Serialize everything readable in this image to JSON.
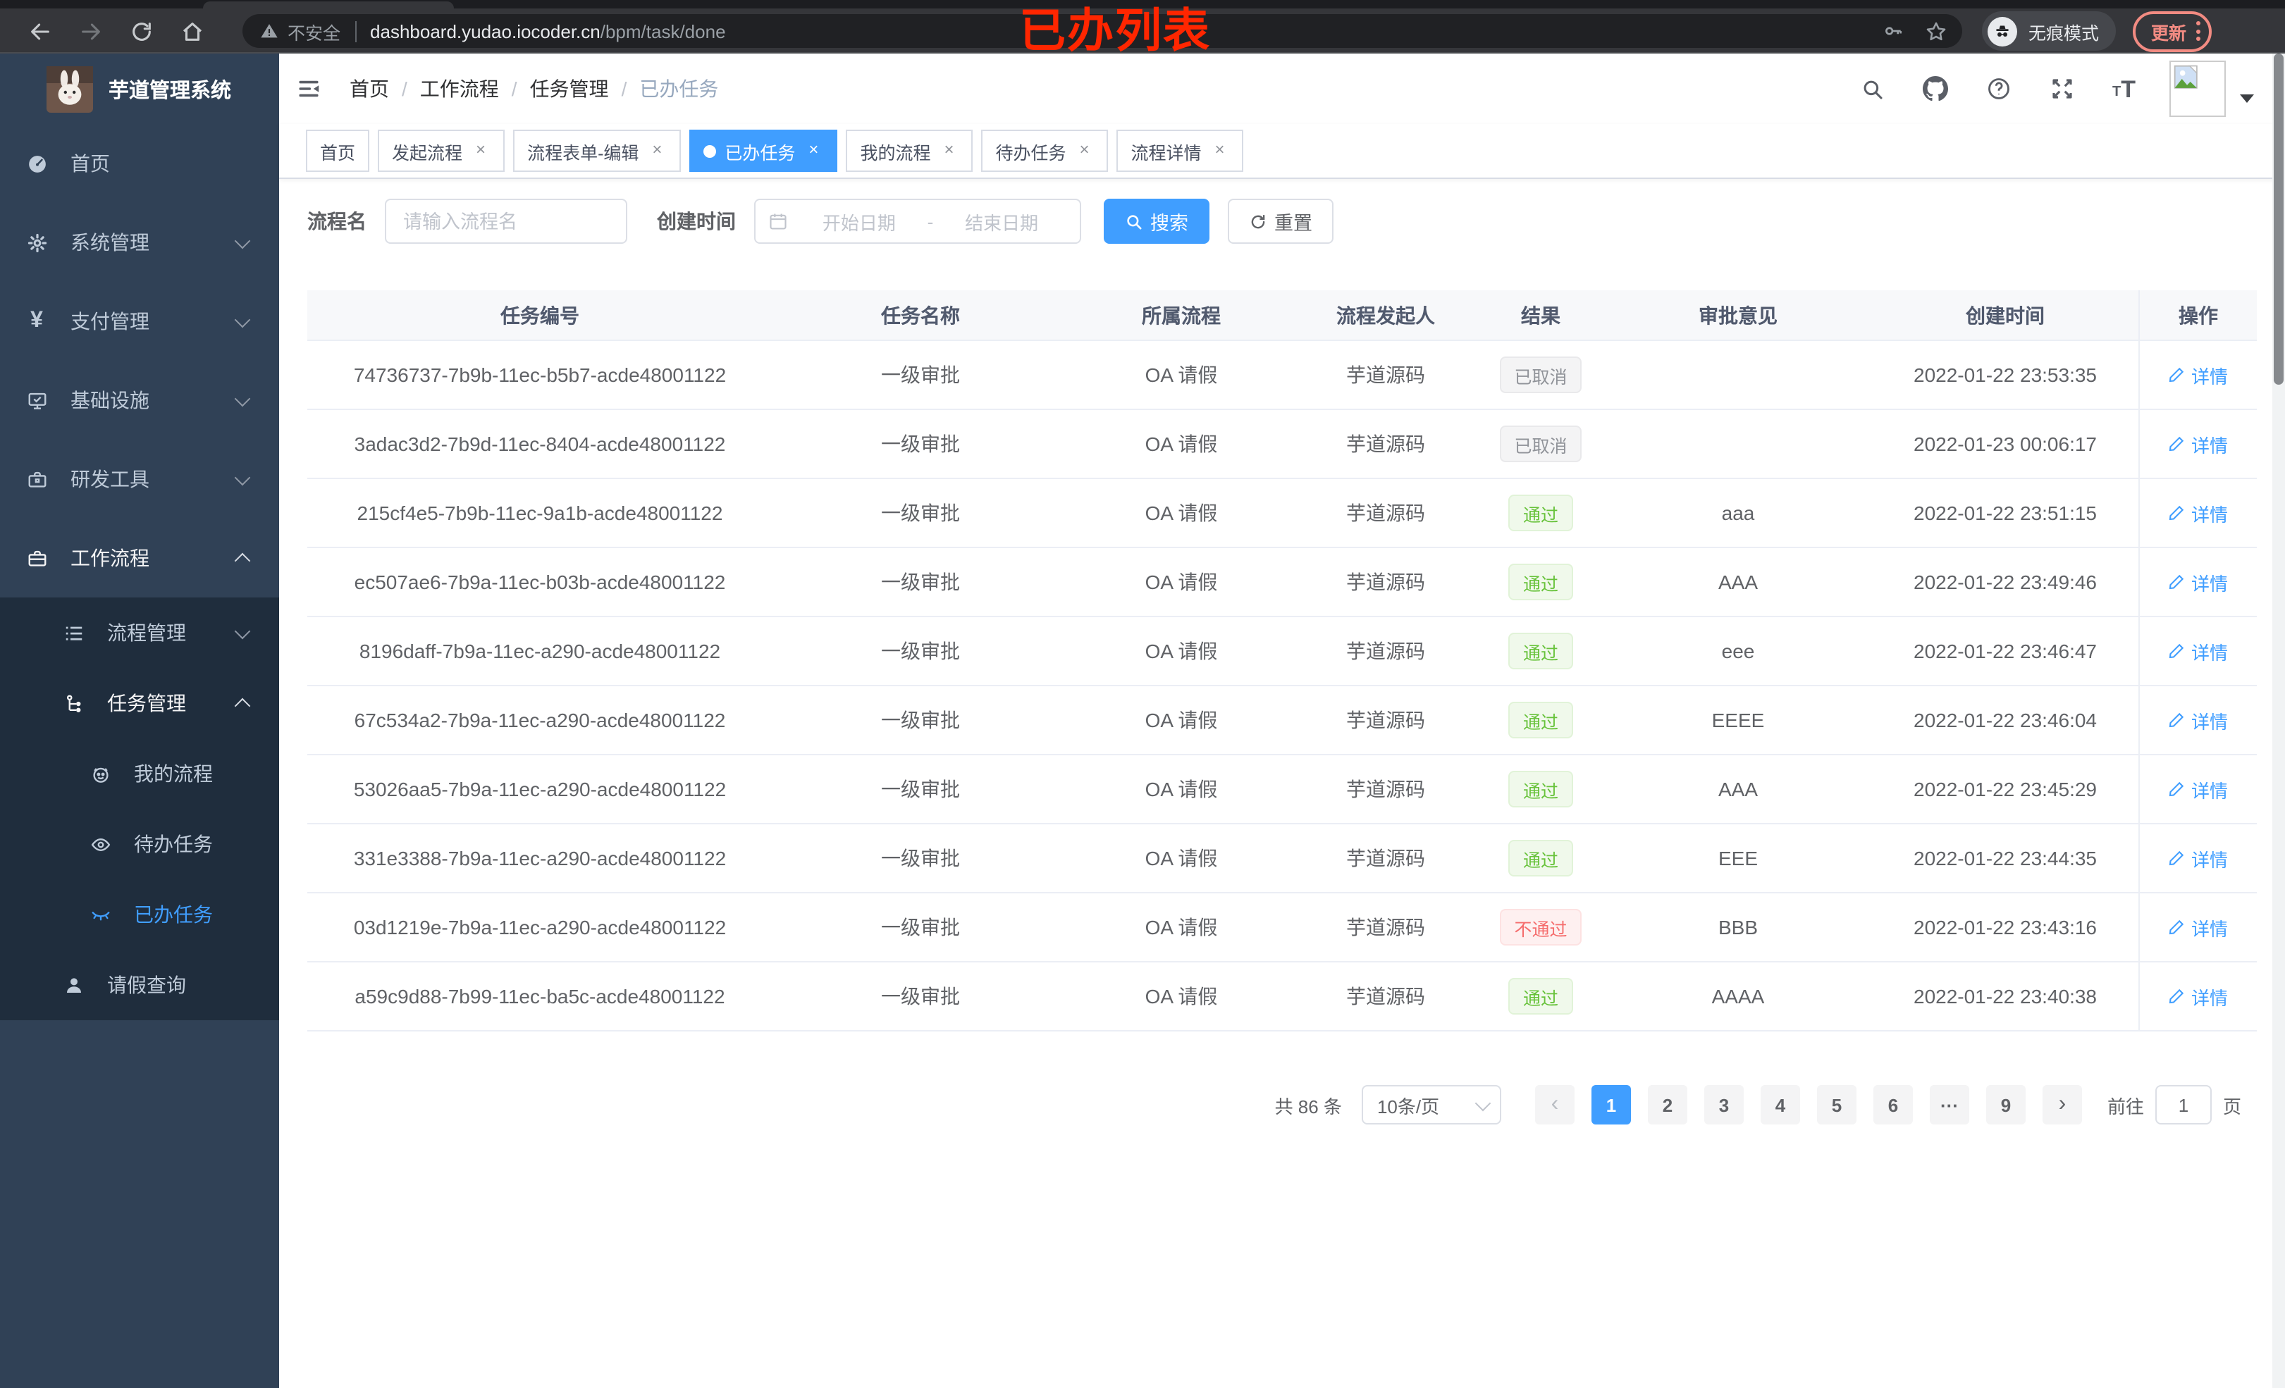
{
  "browser": {
    "security_label": "不安全",
    "url_host": "dashboard.yudao.iocoder.cn",
    "url_path": "/bpm/task/done",
    "overlay_title": "已办列表",
    "incognito_label": "无痕模式",
    "update_label": "更新"
  },
  "sidebar": {
    "app_title": "芋道管理系统",
    "menu": [
      {
        "label": "首页",
        "icon": "dashboard-icon"
      },
      {
        "label": "系统管理",
        "icon": "gear-icon"
      },
      {
        "label": "支付管理",
        "icon": "yen-icon"
      },
      {
        "label": "基础设施",
        "icon": "monitor-icon"
      },
      {
        "label": "研发工具",
        "icon": "toolbox-icon"
      },
      {
        "label": "工作流程",
        "icon": "briefcase-icon"
      },
      {
        "label": "流程管理",
        "icon": "list-tree-icon"
      },
      {
        "label": "任务管理",
        "icon": "flow-tree-icon"
      },
      {
        "label": "我的流程",
        "icon": "face-icon"
      },
      {
        "label": "待办任务",
        "icon": "eye-open-icon"
      },
      {
        "label": "已办任务",
        "icon": "eye-closed-icon"
      },
      {
        "label": "请假查询",
        "icon": "user-icon"
      }
    ]
  },
  "header": {
    "breadcrumb": [
      "首页",
      "工作流程",
      "任务管理",
      "已办任务"
    ],
    "breadcrumb_separator": "/"
  },
  "tabs": {
    "close_glyph": "×",
    "items": [
      {
        "label": "首页",
        "closable": false,
        "active": false
      },
      {
        "label": "发起流程",
        "closable": true,
        "active": false
      },
      {
        "label": "流程表单-编辑",
        "closable": true,
        "active": false
      },
      {
        "label": "已办任务",
        "closable": true,
        "active": true
      },
      {
        "label": "我的流程",
        "closable": true,
        "active": false
      },
      {
        "label": "待办任务",
        "closable": true,
        "active": false
      },
      {
        "label": "流程详情",
        "closable": true,
        "active": false
      }
    ]
  },
  "filters": {
    "name_label": "流程名",
    "name_placeholder": "请输入流程名",
    "time_label": "创建时间",
    "start_placeholder": "开始日期",
    "range_separator": "-",
    "end_placeholder": "结束日期",
    "search_label": "搜索",
    "reset_label": "重置"
  },
  "table": {
    "columns": [
      "任务编号",
      "任务名称",
      "所属流程",
      "流程发起人",
      "结果",
      "审批意见",
      "创建时间",
      "操作"
    ],
    "action_label": "详情",
    "rows": [
      {
        "id": "74736737-7b9b-11ec-b5b7-acde48001122",
        "name": "一级审批",
        "process": "OA 请假",
        "starter": "芋道源码",
        "result": "已取消",
        "result_type": "info",
        "opinion": "",
        "time": "2022-01-22 23:53:35"
      },
      {
        "id": "3adac3d2-7b9d-11ec-8404-acde48001122",
        "name": "一级审批",
        "process": "OA 请假",
        "starter": "芋道源码",
        "result": "已取消",
        "result_type": "info",
        "opinion": "",
        "time": "2022-01-23 00:06:17"
      },
      {
        "id": "215cf4e5-7b9b-11ec-9a1b-acde48001122",
        "name": "一级审批",
        "process": "OA 请假",
        "starter": "芋道源码",
        "result": "通过",
        "result_type": "success",
        "opinion": "aaa",
        "time": "2022-01-22 23:51:15"
      },
      {
        "id": "ec507ae6-7b9a-11ec-b03b-acde48001122",
        "name": "一级审批",
        "process": "OA 请假",
        "starter": "芋道源码",
        "result": "通过",
        "result_type": "success",
        "opinion": "AAA",
        "time": "2022-01-22 23:49:46"
      },
      {
        "id": "8196daff-7b9a-11ec-a290-acde48001122",
        "name": "一级审批",
        "process": "OA 请假",
        "starter": "芋道源码",
        "result": "通过",
        "result_type": "success",
        "opinion": "eee",
        "time": "2022-01-22 23:46:47"
      },
      {
        "id": "67c534a2-7b9a-11ec-a290-acde48001122",
        "name": "一级审批",
        "process": "OA 请假",
        "starter": "芋道源码",
        "result": "通过",
        "result_type": "success",
        "opinion": "EEEE",
        "time": "2022-01-22 23:46:04"
      },
      {
        "id": "53026aa5-7b9a-11ec-a290-acde48001122",
        "name": "一级审批",
        "process": "OA 请假",
        "starter": "芋道源码",
        "result": "通过",
        "result_type": "success",
        "opinion": "AAA",
        "time": "2022-01-22 23:45:29"
      },
      {
        "id": "331e3388-7b9a-11ec-a290-acde48001122",
        "name": "一级审批",
        "process": "OA 请假",
        "starter": "芋道源码",
        "result": "通过",
        "result_type": "success",
        "opinion": "EEE",
        "time": "2022-01-22 23:44:35"
      },
      {
        "id": "03d1219e-7b9a-11ec-a290-acde48001122",
        "name": "一级审批",
        "process": "OA 请假",
        "starter": "芋道源码",
        "result": "不通过",
        "result_type": "danger",
        "opinion": "BBB",
        "time": "2022-01-22 23:43:16"
      },
      {
        "id": "a59c9d88-7b99-11ec-ba5c-acde48001122",
        "name": "一级审批",
        "process": "OA 请假",
        "starter": "芋道源码",
        "result": "通过",
        "result_type": "success",
        "opinion": "AAAA",
        "time": "2022-01-22 23:40:38"
      }
    ]
  },
  "pagination": {
    "total_label": "共 86 条",
    "page_size_label": "10条/页",
    "prev_glyph": "‹",
    "next_glyph": "›",
    "pages": [
      "1",
      "2",
      "3",
      "4",
      "5",
      "6",
      "···",
      "9"
    ],
    "active_page": "1",
    "goto_label": "前往",
    "goto_value": "1",
    "page_suffix": "页"
  },
  "colors": {
    "accent": "#409eff",
    "success": "#67c23a",
    "danger": "#f56c6c",
    "info": "#909399",
    "sidebar_bg": "#304156",
    "submenu_bg": "#1f2d3d",
    "annotation_red": "#ff2600"
  }
}
